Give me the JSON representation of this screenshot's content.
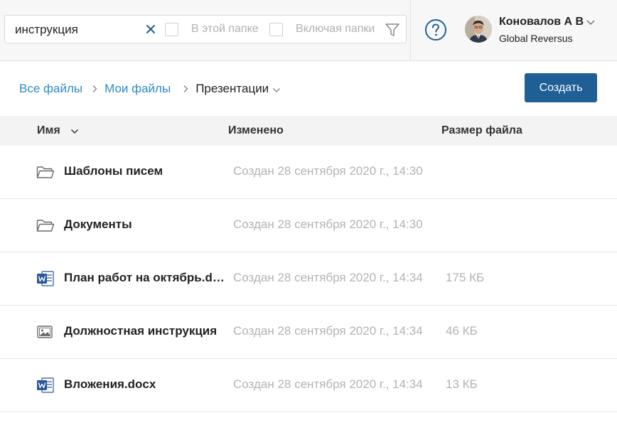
{
  "search": {
    "value": "инструкция",
    "option_in_folder": "В этой папке",
    "option_include_folders": "Включая папки"
  },
  "user": {
    "name": "Коновалов А В",
    "company": "Global Reversus"
  },
  "breadcrumb": {
    "all_files": "Все файлы",
    "my_files": "Мои файлы",
    "current": "Презентации"
  },
  "toolbar": {
    "create_label": "Создать"
  },
  "table": {
    "columns": {
      "name": "Имя",
      "modified": "Изменено",
      "size": "Размер файла"
    },
    "rows": [
      {
        "icon": "folder-icon",
        "name": "Шаблоны писем",
        "modified": "Создан 28 сентября 2020 г., 14:30",
        "size": ""
      },
      {
        "icon": "folder-icon",
        "name": "Документы",
        "modified": "Создан 28 сентября 2020 г., 14:30",
        "size": ""
      },
      {
        "icon": "word-doc-icon",
        "name": "План работ на октябрь.docx",
        "modified": "Создан 28 сентября 2020 г., 14:34",
        "size": "175 КБ"
      },
      {
        "icon": "image-file-icon",
        "name": "Должностная инструкция",
        "modified": "Создан 28 сентября 2020 г., 14:34",
        "size": "46 КБ"
      },
      {
        "icon": "word-doc-icon",
        "name": "Вложения.docx",
        "modified": "Создан 28 сентября 2020 г., 14:34",
        "size": "13 КБ"
      }
    ]
  },
  "colors": {
    "accent": "#1f5f95",
    "link": "#2b8cc4",
    "muted_text": "#b3b3b3",
    "word_blue": "#2b579a"
  }
}
